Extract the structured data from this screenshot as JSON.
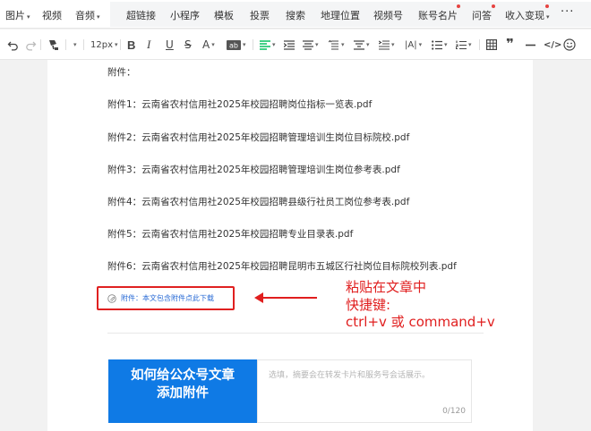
{
  "menu": {
    "left_items": [
      {
        "label": "图片",
        "dropdown": true
      },
      {
        "label": "视频",
        "dropdown": false
      },
      {
        "label": "音频",
        "dropdown": true
      }
    ],
    "right_items": [
      {
        "label": "超链接",
        "dropdown": false,
        "dot": false
      },
      {
        "label": "小程序",
        "dropdown": false,
        "dot": false
      },
      {
        "label": "模板",
        "dropdown": false,
        "dot": false
      },
      {
        "label": "投票",
        "dropdown": false,
        "dot": false
      },
      {
        "label": "搜索",
        "dropdown": false,
        "dot": false
      },
      {
        "label": "地理位置",
        "dropdown": false,
        "dot": false
      },
      {
        "label": "视频号",
        "dropdown": false,
        "dot": false
      },
      {
        "label": "账号名片",
        "dropdown": false,
        "dot": true
      },
      {
        "label": "问答",
        "dropdown": false,
        "dot": true
      },
      {
        "label": "收入变现",
        "dropdown": true,
        "dot": true
      }
    ],
    "more": "···"
  },
  "toolbar": {
    "font_size": "12px",
    "icons": [
      "undo-icon",
      "redo-icon",
      "format-painter-icon",
      "font-size-select",
      "bold-icon",
      "italic-icon",
      "underline-icon",
      "strikethrough-icon",
      "font-color-icon",
      "background-color-icon",
      "align-left-icon",
      "indent-icon",
      "align-center-icon",
      "line-height-icon",
      "paragraph-spacing-icon",
      "text-indent-icon",
      "letter-spacing-icon",
      "list-icon",
      "ordered-list-icon",
      "table-icon",
      "quote-icon",
      "horizontal-rule-icon",
      "code-icon",
      "emoji-icon"
    ]
  },
  "content": {
    "heading": "附件：",
    "attachments": [
      "附件1：云南省农村信用社2025年校园招聘岗位指标一览表.pdf",
      "附件2：云南省农村信用社2025年校园招聘管理培训生岗位目标院校.pdf",
      "附件3：云南省农村信用社2025年校园招聘管理培训生岗位参考表.pdf",
      "附件4：云南省农村信用社2025年校园招聘县级行社员工岗位参考表.pdf",
      "附件5：云南省农村信用社2025年校园招聘专业目录表.pdf",
      "附件6：云南省农村信用社2025年校园招聘昆明市五城区行社岗位目标院校列表.pdf"
    ],
    "attach_card": "附件：本文包含附件点此下载"
  },
  "annotation": {
    "line1": "粘贴在文章中",
    "line2": "快捷键:",
    "line3": "ctrl+v 或 command+v"
  },
  "cover": {
    "line1": "如何给公众号文章",
    "line2": "添加附件"
  },
  "summary": {
    "placeholder": "选填，摘要会在转发卡片和服务号会话展示。",
    "counter": "0/120"
  },
  "colors": {
    "accent_green": "#07c160",
    "link_blue": "#2b6cd6",
    "annotation_red": "#e01e1e",
    "cover_blue": "#0f7ae5",
    "notice_dot": "#e64340"
  }
}
